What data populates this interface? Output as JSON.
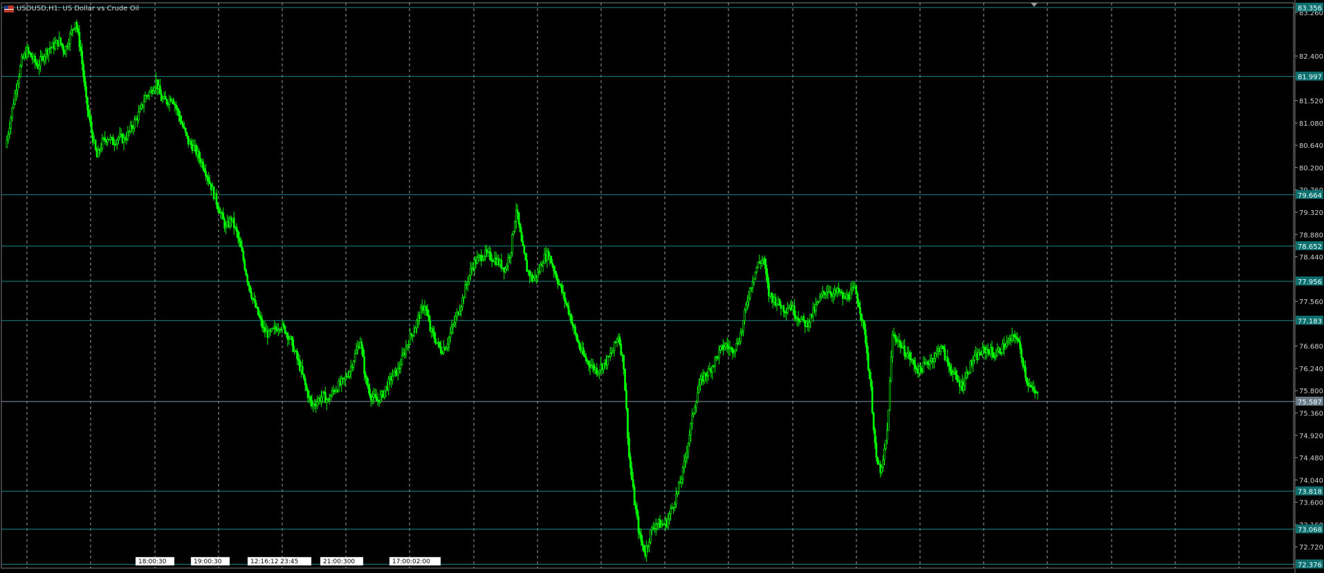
{
  "window": {
    "title": "USOUSD,H1:  US Dollar vs Crude Oil",
    "flag_icon": "us-flag-icon"
  },
  "colors": {
    "background": "#000000",
    "candle": "#00ff00",
    "grid": "#c8c8c8",
    "level_line": "#1a8a8a",
    "level_tag_bg": "#0f6f6f",
    "current_price_bg": "#6b7a87"
  },
  "axis": {
    "ticks": [
      "83.260",
      "82.400",
      "81.520",
      "81.080",
      "80.640",
      "80.200",
      "79.760",
      "79.320",
      "78.880",
      "78.440",
      "77.560",
      "76.680",
      "76.240",
      "75.800",
      "75.360",
      "74.920",
      "74.480",
      "74.040",
      "73.600",
      "73.160",
      "72.720"
    ]
  },
  "levels": [
    {
      "label": "83.356",
      "price": 83.356
    },
    {
      "label": "81.997",
      "price": 81.997
    },
    {
      "label": "79.664",
      "price": 79.664
    },
    {
      "label": "78.652",
      "price": 78.652
    },
    {
      "label": "77.956",
      "price": 77.956
    },
    {
      "label": "77.183",
      "price": 77.183
    },
    {
      "label": "73.818",
      "price": 73.818
    },
    {
      "label": "73.068",
      "price": 73.068
    },
    {
      "label": "72.376",
      "price": 72.376
    }
  ],
  "current_price": {
    "label": "75.587",
    "price": 75.587
  },
  "time_tags": [
    {
      "label": "18:00:30"
    },
    {
      "label": "19:00:30"
    },
    {
      "label": "12:16:12 23:45"
    },
    {
      "label": "21:00:300"
    },
    {
      "label": "17:00:02:00"
    }
  ],
  "chart_data": {
    "type": "line",
    "symbol": "USOUSD",
    "timeframe": "H1",
    "ylim": [
      72.3,
      83.45
    ],
    "grid": true,
    "series": [
      {
        "values": [
          80.6,
          81.2,
          81.8,
          82.3,
          82.5,
          82.35,
          82.2,
          82.4,
          82.55,
          82.6,
          82.7,
          82.5,
          82.8,
          83.1,
          82.5,
          81.5,
          80.9,
          80.4,
          80.7,
          80.8,
          80.7,
          80.8,
          80.75,
          80.9,
          81.1,
          81.3,
          81.6,
          81.7,
          81.9,
          81.55,
          81.5,
          81.6,
          81.3,
          81.0,
          80.7,
          80.6,
          80.4,
          80.2,
          79.9,
          79.6,
          79.3,
          79.0,
          79.2,
          78.9,
          78.5,
          78.0,
          77.6,
          77.3,
          77.0,
          76.9,
          77.0,
          77.1,
          77.0,
          76.8,
          76.5,
          76.2,
          75.8,
          75.5,
          75.6,
          75.7,
          75.6,
          75.8,
          75.9,
          76.0,
          76.2,
          76.5,
          76.8,
          76.0,
          75.7,
          75.6,
          75.7,
          75.9,
          76.1,
          76.2,
          76.5,
          76.8,
          77.0,
          77.3,
          77.5,
          77.0,
          76.8,
          76.6,
          76.7,
          77.0,
          77.3,
          77.6,
          78.0,
          78.3,
          78.4,
          78.5,
          78.45,
          78.4,
          78.3,
          78.2,
          78.6,
          79.4,
          78.7,
          78.2,
          78.0,
          78.1,
          78.4,
          78.5,
          78.2,
          77.9,
          77.6,
          77.3,
          76.9,
          76.6,
          76.4,
          76.3,
          76.2,
          76.3,
          76.4,
          76.6,
          76.9,
          76.3,
          74.5,
          73.6,
          72.9,
          72.6,
          73.0,
          73.2,
          73.15,
          73.2,
          73.5,
          73.8,
          74.2,
          74.8,
          75.4,
          75.9,
          76.1,
          76.2,
          76.4,
          76.6,
          76.7,
          76.6,
          76.7,
          77.0,
          77.6,
          78.0,
          78.3,
          78.4,
          77.7,
          77.6,
          77.5,
          77.4,
          77.5,
          77.3,
          77.2,
          77.1,
          77.3,
          77.5,
          77.7,
          77.8,
          77.7,
          77.75,
          77.6,
          77.7,
          77.8,
          77.4,
          76.8,
          75.8,
          74.4,
          74.2,
          75.0,
          76.9,
          76.8,
          76.6,
          76.5,
          76.3,
          76.2,
          76.3,
          76.4,
          76.5,
          76.7,
          76.4,
          76.2,
          76.0,
          75.9,
          76.2,
          76.4,
          76.5,
          76.6,
          76.6,
          76.5,
          76.6,
          76.7,
          76.8,
          76.9,
          76.5,
          76.0,
          75.8,
          75.7
        ]
      }
    ]
  }
}
